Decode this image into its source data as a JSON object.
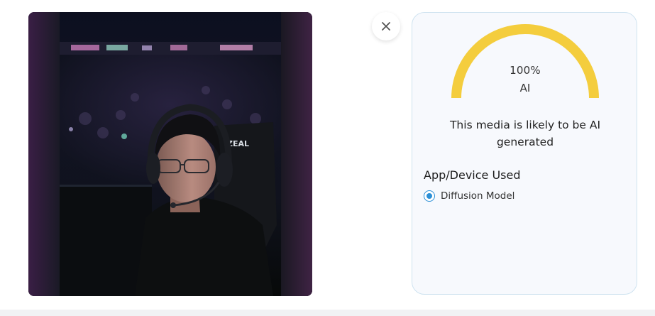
{
  "result": {
    "percentage": "100%",
    "label": "AI",
    "score": 1.0,
    "gauge_color": "#f4cd3d",
    "verdict": "This media is likely to be AI generated"
  },
  "device": {
    "heading": "App/Device Used",
    "options": [
      {
        "label": "Diffusion Model",
        "selected": true
      }
    ]
  },
  "icons": {
    "close": "close-icon",
    "radio": "radio-selected-icon"
  },
  "colors": {
    "accent": "#2b8fd6",
    "panel_border": "#cfe3f0",
    "panel_bg": "#f7f9fd"
  },
  "image": {
    "jersey_text": "ZEAL"
  }
}
